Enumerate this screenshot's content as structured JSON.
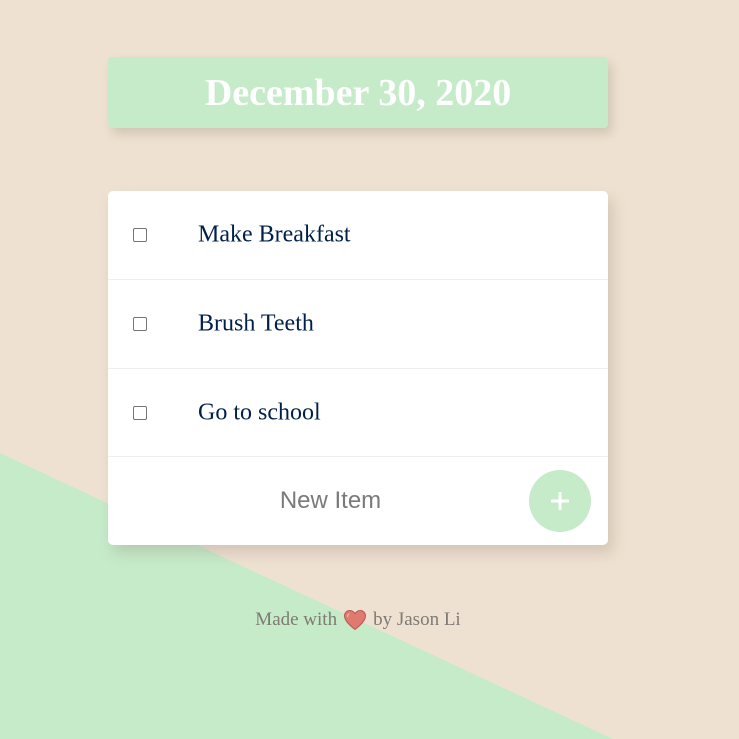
{
  "header": {
    "date": "December 30, 2020"
  },
  "todo": {
    "items": [
      {
        "label": "Make Breakfast",
        "checked": false
      },
      {
        "label": "Brush Teeth",
        "checked": false
      },
      {
        "label": "Go to school",
        "checked": false
      }
    ],
    "new_item_placeholder": "New Item",
    "add_button_icon": "plus-icon"
  },
  "footer": {
    "made_with": "Made with",
    "heart_icon": "heart-icon",
    "by": "by Jason Li"
  },
  "colors": {
    "background": "#efe1d1",
    "accent": "#c6ebc9",
    "item_text": "#00204a",
    "footer_text": "#7e7a74",
    "heart": "#e07a6f"
  }
}
